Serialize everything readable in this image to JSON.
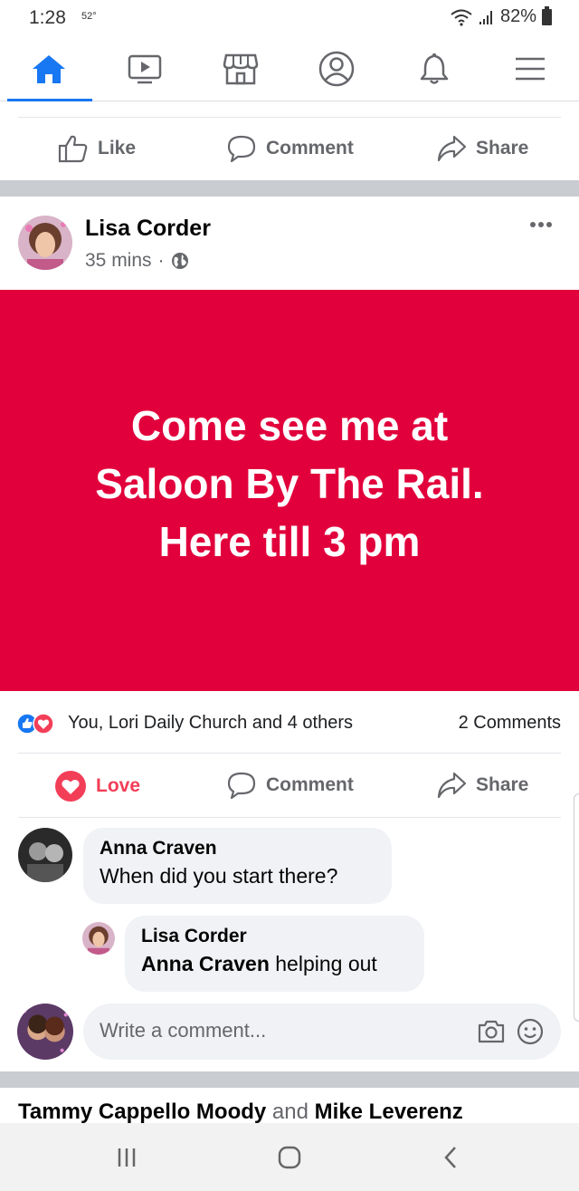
{
  "status_bar": {
    "time": "1:28",
    "temperature": "52°",
    "battery": "82%",
    "icons": [
      "wifi-icon",
      "signal-icon",
      "battery-icon"
    ]
  },
  "nav": {
    "items": [
      {
        "name": "home",
        "icon": "home-icon",
        "active": true
      },
      {
        "name": "watch",
        "icon": "video-icon",
        "active": false
      },
      {
        "name": "marketplace",
        "icon": "store-icon",
        "active": false
      },
      {
        "name": "profile",
        "icon": "profile-icon",
        "active": false
      },
      {
        "name": "notifications",
        "icon": "bell-icon",
        "active": false
      },
      {
        "name": "menu",
        "icon": "hamburger-icon",
        "active": false
      }
    ],
    "accent_color": "#1877f2"
  },
  "prev_post_actions": {
    "like": "Like",
    "comment": "Comment",
    "share": "Share"
  },
  "post": {
    "author": "Lisa Corder",
    "time": "35 mins",
    "separator": "·",
    "privacy_icon": "globe-icon",
    "background_color": "#e2003c",
    "text_lines": [
      "Come see me at",
      "Saloon By The Rail.",
      "Here till 3 pm"
    ],
    "reactions_text": "You, Lori Daily Church and 4 others",
    "reaction_icons": [
      "like-reaction-icon",
      "love-reaction-icon"
    ],
    "comments_count": "2 Comments",
    "actions": {
      "love": "Love",
      "comment": "Comment",
      "share": "Share"
    },
    "love_color": "#f33e58"
  },
  "comments": [
    {
      "author": "Anna Craven",
      "text": "When did you start there?"
    },
    {
      "author": "Lisa Corder",
      "mention": "Anna Craven",
      "text": " helping out"
    }
  ],
  "comment_box": {
    "placeholder": "Write a comment...",
    "icons": [
      "camera-icon",
      "emoji-icon"
    ]
  },
  "next_post": {
    "name1": "Tammy Cappello Moody",
    "connector": " and ",
    "name2": "Mike Leverenz"
  },
  "android_nav": [
    "recents-icon",
    "home-circle-icon",
    "back-icon"
  ]
}
